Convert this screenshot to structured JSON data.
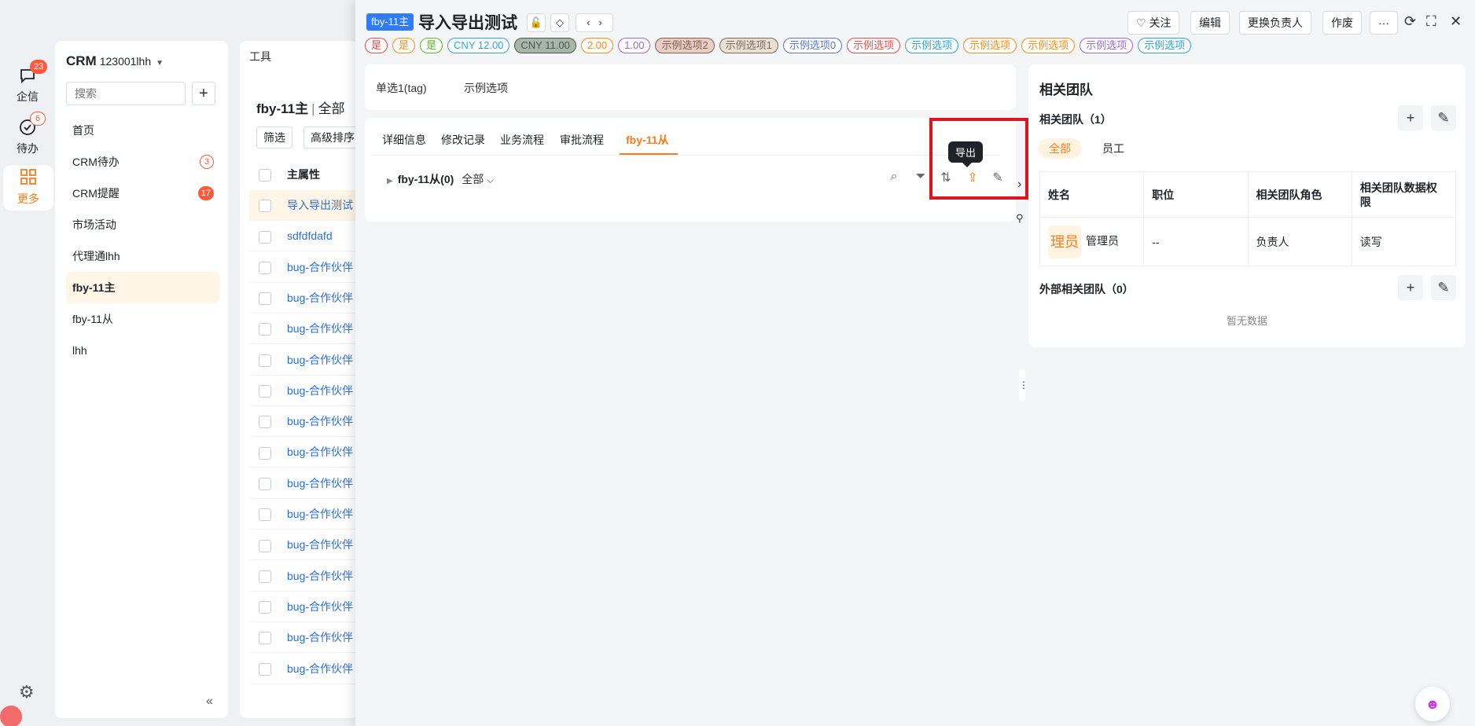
{
  "rail": {
    "items": [
      {
        "label": "企信",
        "badge": "23",
        "icon": "chat-icon"
      },
      {
        "label": "待办",
        "badge": "6",
        "icon": "check-circle-icon"
      },
      {
        "label": "更多",
        "icon": "grid-icon"
      }
    ]
  },
  "nav": {
    "app": "CRM",
    "account": "123001lhh",
    "search_placeholder": "搜索",
    "add": "+",
    "items": [
      {
        "label": "首页"
      },
      {
        "label": "CRM待办",
        "count": "3"
      },
      {
        "label": "CRM提醒",
        "count": "17"
      },
      {
        "label": "市场活动"
      },
      {
        "label": "代理通lhh"
      },
      {
        "label": "fby-11主"
      },
      {
        "label": "fby-11从"
      },
      {
        "label": "lhh"
      }
    ],
    "collapse": "«"
  },
  "list": {
    "toolbar": "工具",
    "title": "fby-11主",
    "sep": "|",
    "scope": "全部",
    "filter_btn": "筛选",
    "sort_btn": "高级排序",
    "col_header": "主属性",
    "rows": [
      "导入导出测试",
      "sdfdfdafd",
      "bug-合作伙伴",
      "bug-合作伙伴",
      "bug-合作伙伴",
      "bug-合作伙伴",
      "bug-合作伙伴",
      "bug-合作伙伴",
      "bug-合作伙伴",
      "bug-合作伙伴",
      "bug-合作伙伴",
      "bug-合作伙伴",
      "bug-合作伙伴",
      "bug-合作伙伴",
      "bug-合作伙伴",
      "bug-合作伙伴"
    ]
  },
  "detail": {
    "object_tag": "fby-11主",
    "title": "导入导出测试",
    "buttons": {
      "follow": "♡ 关注",
      "edit": "编辑",
      "change_owner": "更换负责人",
      "void": "作废",
      "more": "···"
    },
    "chips": [
      {
        "text": "是",
        "color": "#f5484b"
      },
      {
        "text": "是",
        "color": "#ff8c1a"
      },
      {
        "text": "是",
        "color": "#5cb82a"
      },
      {
        "text": "CNY 12.00",
        "color": "#2fa6d8"
      },
      {
        "text": "CNY 11.00",
        "color": "#4a5a4a",
        "fill": "#a9b5a9"
      },
      {
        "text": "2.00",
        "color": "#ff8c1a"
      },
      {
        "text": "1.00",
        "color": "#9b6ad6"
      },
      {
        "text": "示例选项2",
        "color": "#8a5a4a",
        "fill": "#e6cfc7"
      },
      {
        "text": "示例选项1",
        "color": "#7a6a5a",
        "fill": "#e8e0d4"
      },
      {
        "text": "示例选项0",
        "color": "#5a7ac6"
      },
      {
        "text": "示例选项",
        "color": "#f5484b"
      },
      {
        "text": "示例选项",
        "color": "#2fa6d8"
      },
      {
        "text": "示例选项",
        "color": "#ff8c1a"
      },
      {
        "text": "示例选项",
        "color": "#ff8c1a"
      },
      {
        "text": "示例选项",
        "color": "#9b6ad6"
      },
      {
        "text": "示例选项",
        "color": "#2fa6d8"
      }
    ],
    "summary": {
      "field": "单选1(tag)",
      "value": "示例选项"
    },
    "tabs": [
      "详细信息",
      "修改记录",
      "业务流程",
      "审批流程",
      "fby-11从"
    ],
    "related": {
      "name": "fby-11从(0)",
      "scope": "全部"
    },
    "tooltip": "导出",
    "team": {
      "title": "相关团队",
      "section": "相关团队（1）",
      "filters": [
        "全部",
        "员工"
      ],
      "columns": [
        "姓名",
        "职位",
        "相关团队角色",
        "相关团队数据权限"
      ],
      "rows": [
        {
          "avatar": "理员",
          "name": "管理员",
          "position": "--",
          "role": "负责人",
          "perm": "读写"
        }
      ],
      "external": "外部相关团队（0）",
      "empty": "暂无数据"
    }
  },
  "colors": {
    "accent": "#ff7a1a",
    "link": "#2b6fde",
    "highlight": "#e0141e"
  }
}
